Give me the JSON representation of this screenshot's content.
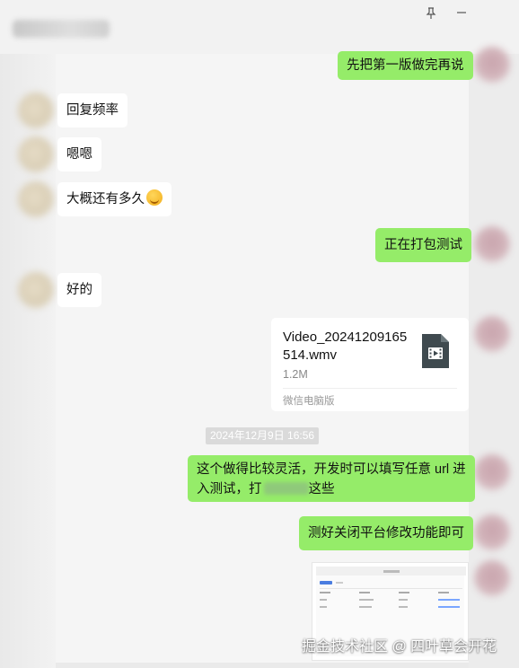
{
  "window": {
    "pin_icon": "pin-icon",
    "minimize_icon": "minimize-icon"
  },
  "messages": [
    {
      "id": "m1",
      "side": "out",
      "text": "先把第一版做完再说"
    },
    {
      "id": "m2",
      "side": "in",
      "text": "回复频率"
    },
    {
      "id": "m3",
      "side": "in",
      "text": "嗯嗯"
    },
    {
      "id": "m4",
      "side": "in",
      "text": "大概还有多久",
      "emoji": "grinning-emoji"
    },
    {
      "id": "m5",
      "side": "out",
      "text": "正在打包测试"
    },
    {
      "id": "m6",
      "side": "in",
      "text": "好的"
    },
    {
      "id": "m7",
      "side": "out",
      "type": "file",
      "file_name": "Video_20241209165514.wmv",
      "file_size": "1.2M",
      "source": "微信电脑版",
      "icon": "video-file-icon"
    },
    {
      "id": "m8",
      "side": "out",
      "text_line1": "这个做得比较灵活，开发时可以填写任意 url 进",
      "text_line2_a": "入测试，打",
      "text_line2_b": "这些"
    },
    {
      "id": "m9",
      "side": "out",
      "text": "测好关闭平台修改功能即可"
    },
    {
      "id": "m10",
      "side": "out",
      "type": "image",
      "image_desc": "screenshot-thumbnail"
    }
  ],
  "timestamp": "2024年12月9日 16:56",
  "watermark": "掘金技术社区 @ 四叶草会开花",
  "colors": {
    "outgoing_bubble": "#95ec69",
    "incoming_bubble": "#ffffff",
    "background": "#f5f5f5"
  }
}
